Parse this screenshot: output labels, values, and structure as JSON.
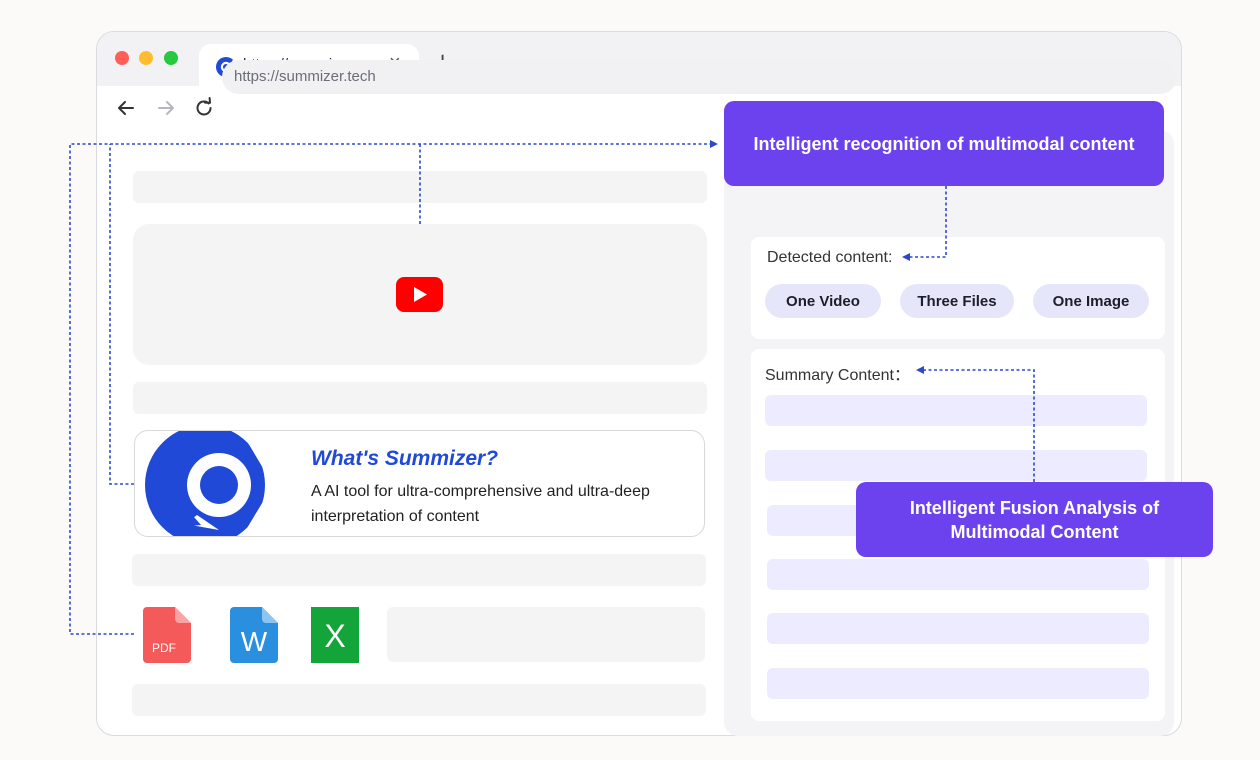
{
  "browser": {
    "tab_title": "https://summizer...",
    "tab_close_icon": "×",
    "new_tab_icon": "+",
    "url": "https://summizer.tech"
  },
  "card": {
    "title": "What's Summizer?",
    "description": "A AI tool for ultra-comprehensive and ultra-deep interpretation of content"
  },
  "files": [
    {
      "name": "pdf-file-icon",
      "label": "PDF",
      "color": "#f55a5a"
    },
    {
      "name": "word-file-icon",
      "label": "W",
      "color": "#2b8fe0"
    },
    {
      "name": "excel-file-icon",
      "label": "X",
      "color": "#13a53a"
    }
  ],
  "detected": {
    "label": "Detected content:",
    "items": [
      "One Video",
      "Three Files",
      "One Image"
    ]
  },
  "summary": {
    "label": "Summary Content："
  },
  "callouts": {
    "recognition": "Intelligent recognition of multimodal content",
    "fusion": "Intelligent Fusion Analysis of Multimodal Content"
  },
  "colors": {
    "accent": "#6c42ee",
    "brand_blue": "#1f49d6",
    "connector": "#2f48c9",
    "youtube_red": "#ff0000"
  }
}
